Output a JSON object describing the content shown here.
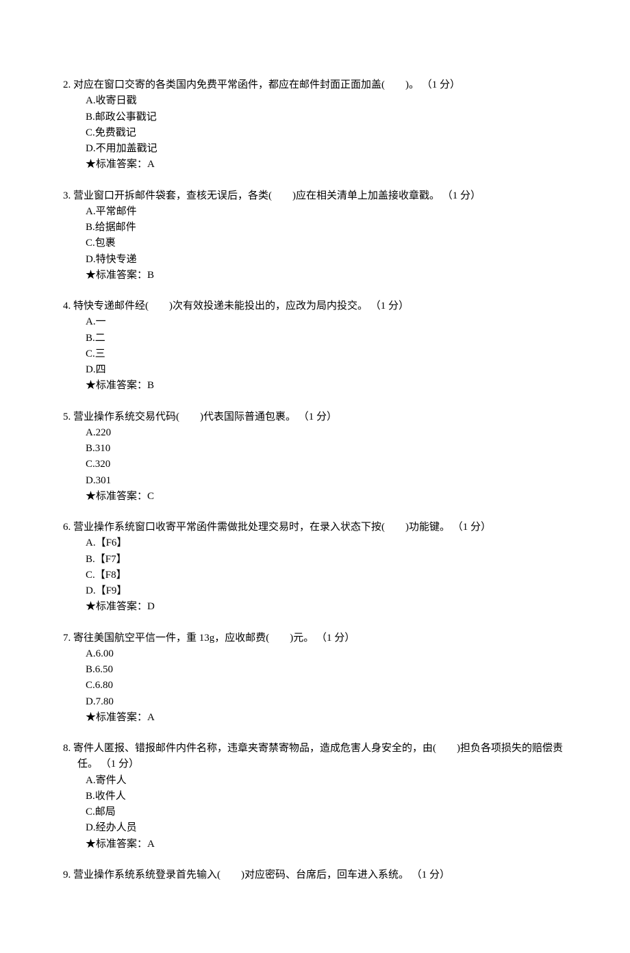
{
  "questions": [
    {
      "number": "2.",
      "stem_parts": [
        "对应在窗口交寄的各类国内免费平常函件，都应在邮件封面正面加盖(　　)。 （1 分）"
      ],
      "options": [
        "A.收寄日戳",
        "B.邮政公事戳记",
        "C.免费戳记",
        "D.不用加盖戳记"
      ],
      "answer": "★标准答案：A"
    },
    {
      "number": "3.",
      "stem_parts": [
        "营业窗口开拆邮件袋套，查核无误后，各类(　　)应在相关清单上加盖接收章戳。 （1 分）"
      ],
      "options": [
        "A.平常邮件",
        "B.给据邮件",
        "C.包裹",
        "D.特快专递"
      ],
      "answer": "★标准答案：B"
    },
    {
      "number": "4.",
      "stem_parts": [
        "特快专递邮件经(　　)次有效投递未能投出的，应改为局内投交。 （1 分）"
      ],
      "options": [
        "A.一",
        "B.二",
        "C.三",
        "D.四"
      ],
      "answer": "★标准答案：B"
    },
    {
      "number": "5.",
      "stem_parts": [
        "营业操作系统交易代码(　　)代表国际普通包裹。 （1 分）"
      ],
      "options": [
        "A.220",
        "B.310",
        "C.320",
        "D.301"
      ],
      "answer": "★标准答案：C"
    },
    {
      "number": "6.",
      "stem_parts": [
        "营业操作系统窗口收寄平常函件需做批处理交易时，在录入状态下按(　　)功能键。 （1 分）"
      ],
      "options": [
        "A.【F6】",
        "B.【F7】",
        "C.【F8】",
        "D.【F9】"
      ],
      "answer": "★标准答案：D"
    },
    {
      "number": "7.",
      "stem_parts": [
        "寄往美国航空平信一件，重 13g，应收邮费(　　)元。 （1 分）"
      ],
      "options": [
        "A.6.00",
        "B.6.50",
        "C.6.80",
        "D.7.80"
      ],
      "answer": "★标准答案：A"
    },
    {
      "number": "8.",
      "stem_parts": [
        "寄件人匿报、错报邮件内件名称，违章夹寄禁寄物品，造成危害人身安全的，由(　　)担负各项损失的赔偿责任。 （1 分）"
      ],
      "options": [
        "A.寄件人",
        "B.收件人",
        "C.邮局",
        "D.经办人员"
      ],
      "answer": "★标准答案：A"
    },
    {
      "number": "9.",
      "stem_parts": [
        "营业操作系统系统登录首先输入(　　)对应密码、台席后，回车进入系统。 （1 分）"
      ],
      "options": [],
      "answer": ""
    }
  ]
}
